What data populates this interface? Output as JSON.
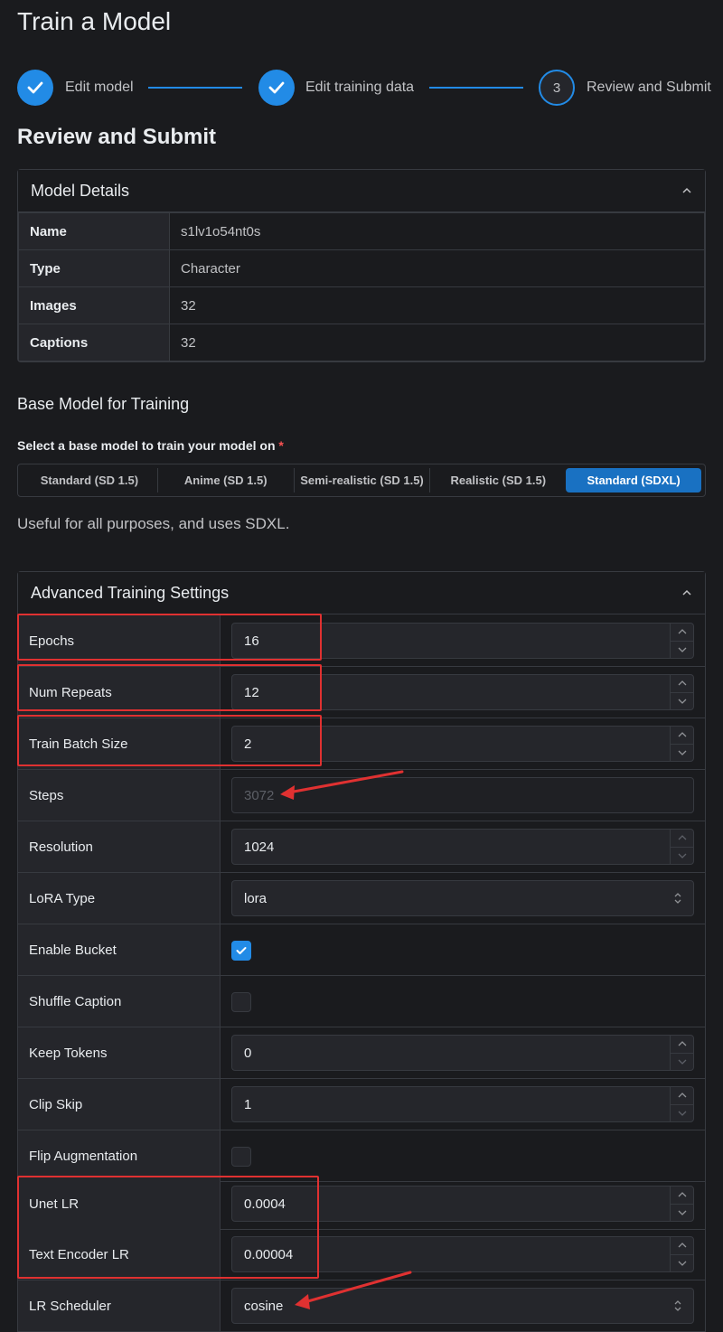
{
  "page": {
    "title": "Train a Model"
  },
  "stepper": {
    "steps": [
      {
        "label": "Edit model",
        "state": "done"
      },
      {
        "label": "Edit training data",
        "state": "done"
      },
      {
        "label": "Review and Submit",
        "state": "current",
        "number": "3"
      }
    ]
  },
  "review": {
    "title": "Review and Submit",
    "details_panel": {
      "header": "Model Details",
      "rows": [
        {
          "key": "Name",
          "value": "s1lv1o54nt0s"
        },
        {
          "key": "Type",
          "value": "Character"
        },
        {
          "key": "Images",
          "value": "32"
        },
        {
          "key": "Captions",
          "value": "32"
        }
      ]
    }
  },
  "base_model": {
    "title": "Base Model for Training",
    "label": "Select a base model to train your model on",
    "required_mark": "*",
    "options": [
      "Standard (SD 1.5)",
      "Anime (SD 1.5)",
      "Semi-realistic (SD 1.5)",
      "Realistic (SD 1.5)",
      "Standard (SDXL)"
    ],
    "selected": "Standard (SDXL)",
    "description": "Useful for all purposes, and uses SDXL."
  },
  "advanced": {
    "header": "Advanced Training Settings",
    "fields": {
      "epochs": {
        "label": "Epochs",
        "value": "16"
      },
      "num_repeats": {
        "label": "Num Repeats",
        "value": "12"
      },
      "train_batch_size": {
        "label": "Train Batch Size",
        "value": "2"
      },
      "steps": {
        "label": "Steps",
        "value": "3072"
      },
      "resolution": {
        "label": "Resolution",
        "value": "1024"
      },
      "lora_type": {
        "label": "LoRA Type",
        "value": "lora"
      },
      "enable_bucket": {
        "label": "Enable Bucket",
        "checked": true
      },
      "shuffle_caption": {
        "label": "Shuffle Caption",
        "checked": false
      },
      "keep_tokens": {
        "label": "Keep Tokens",
        "value": "0"
      },
      "clip_skip": {
        "label": "Clip Skip",
        "value": "1"
      },
      "flip_augmentation": {
        "label": "Flip Augmentation",
        "checked": false
      },
      "unet_lr": {
        "label": "Unet LR",
        "value": "0.0004"
      },
      "text_encoder_lr": {
        "label": "Text Encoder LR",
        "value": "0.00004"
      },
      "lr_scheduler": {
        "label": "LR Scheduler",
        "value": "cosine"
      }
    }
  },
  "colors": {
    "accent": "#228be6",
    "annotation": "#e03131",
    "background": "#1a1b1e"
  }
}
